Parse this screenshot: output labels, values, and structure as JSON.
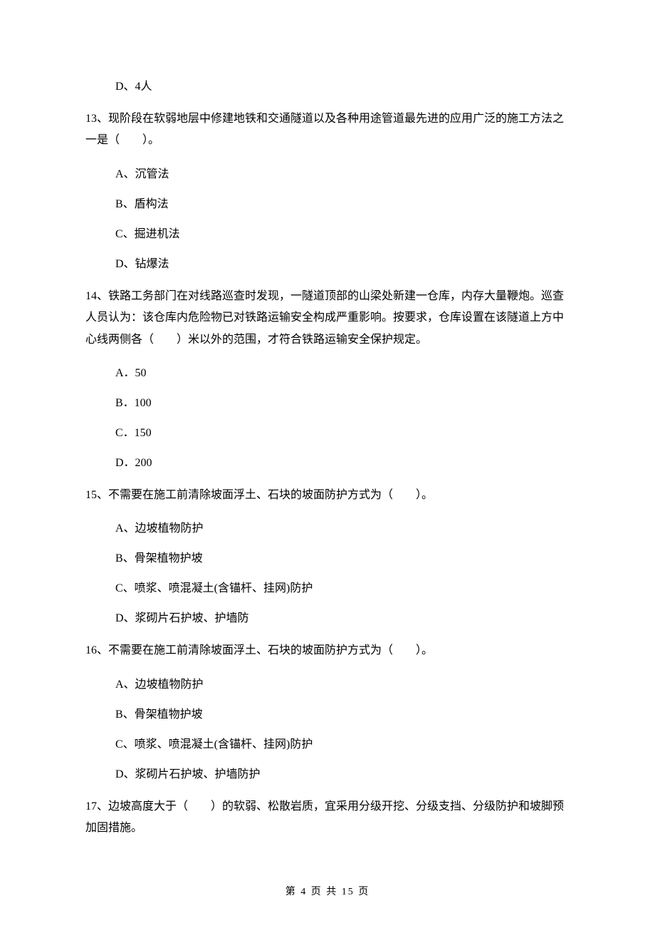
{
  "q12": {
    "opt_d": "D、4人"
  },
  "q13": {
    "stem": "13、现阶段在软弱地层中修建地铁和交通隧道以及各种用途管道最先进的应用广泛的施工方法之一是（　　）。",
    "a": "A、沉管法",
    "b": "B、盾构法",
    "c": "C、掘进机法",
    "d": "D、钻爆法"
  },
  "q14": {
    "stem": "14、铁路工务部门在对线路巡查时发现，一隧道顶部的山梁处新建一仓库，内存大量鞭炮。巡查人员认为：该仓库内危险物已对铁路运输安全构成严重影响。按要求，仓库设置在该隧道上方中心线两侧各（　　）米以外的范围，才符合铁路运输安全保护规定。",
    "a": "A．50",
    "b": "B．100",
    "c": "C．150",
    "d": "D．200"
  },
  "q15": {
    "stem": "15、不需要在施工前清除坡面浮土、石块的坡面防护方式为（　　）。",
    "a": "A、边坡植物防护",
    "b": "B、骨架植物护坡",
    "c": "C、喷浆、喷混凝土(含锚杆、挂网)防护",
    "d": "D、浆砌片石护坡、护墙防"
  },
  "q16": {
    "stem": "16、不需要在施工前清除坡面浮土、石块的坡面防护方式为（　　）。",
    "a": "A、边坡植物防护",
    "b": "B、骨架植物护坡",
    "c": "C、喷浆、喷混凝土(含锚杆、挂网)防护",
    "d": "D、浆砌片石护坡、护墙防护"
  },
  "q17": {
    "stem": "17、边坡高度大于（　　）的软弱、松散岩质，宜采用分级开挖、分级支挡、分级防护和坡脚预加固措施。"
  },
  "footer": "第 4 页 共 15 页"
}
